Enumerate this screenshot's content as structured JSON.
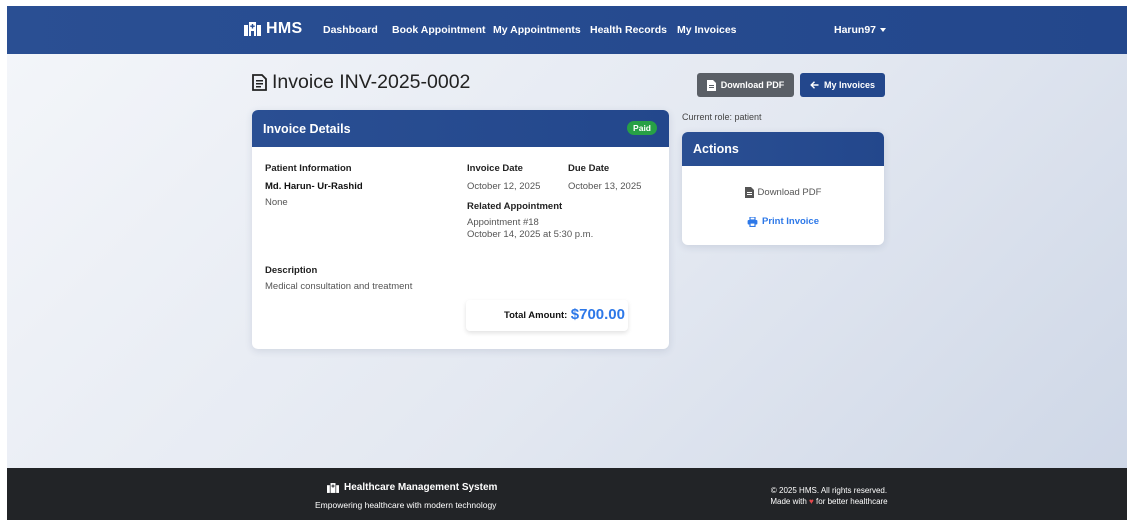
{
  "nav": {
    "brand": "HMS",
    "items": [
      "Dashboard",
      "Book Appointment",
      "My Appointments",
      "Health Records",
      "My Invoices"
    ],
    "user": "Harun97"
  },
  "header": {
    "title": "Invoice INV-2025-0002",
    "download_pdf": "Download PDF",
    "my_invoices": "My Invoices"
  },
  "invoice": {
    "card_title": "Invoice Details",
    "status": "Paid",
    "patient_label": "Patient Information",
    "patient_name": "Md. Harun- Ur-Rashid",
    "patient_extra": "None",
    "invoice_date_label": "Invoice Date",
    "invoice_date": "October 12, 2025",
    "due_date_label": "Due Date",
    "due_date": "October 13, 2025",
    "related_label": "Related Appointment",
    "related_appointment": "Appointment #18",
    "related_datetime": "October 14, 2025 at 5:30 p.m.",
    "description_label": "Description",
    "description": "Medical consultation and treatment",
    "total_label": "Total Amount:",
    "total": "$700.00"
  },
  "role": "Current role: patient",
  "actions": {
    "title": "Actions",
    "download_pdf": "Download PDF",
    "print_invoice": "Print Invoice"
  },
  "footer": {
    "title": "Healthcare Management System",
    "tagline": "Empowering healthcare with modern technology",
    "copyright": "© 2025 HMS. All rights reserved.",
    "made_with_prefix": "Made with",
    "made_with_suffix": "for better healthcare"
  },
  "icons": {
    "brand": "hospital-icon",
    "title": "invoice-icon",
    "download": "file-pdf-icon",
    "back": "arrow-left-icon",
    "print": "printer-icon",
    "heart": "heart-icon"
  },
  "colors": {
    "primary": "#23478c",
    "success": "#27a046",
    "link": "#2d78e8",
    "footer": "#222427"
  }
}
